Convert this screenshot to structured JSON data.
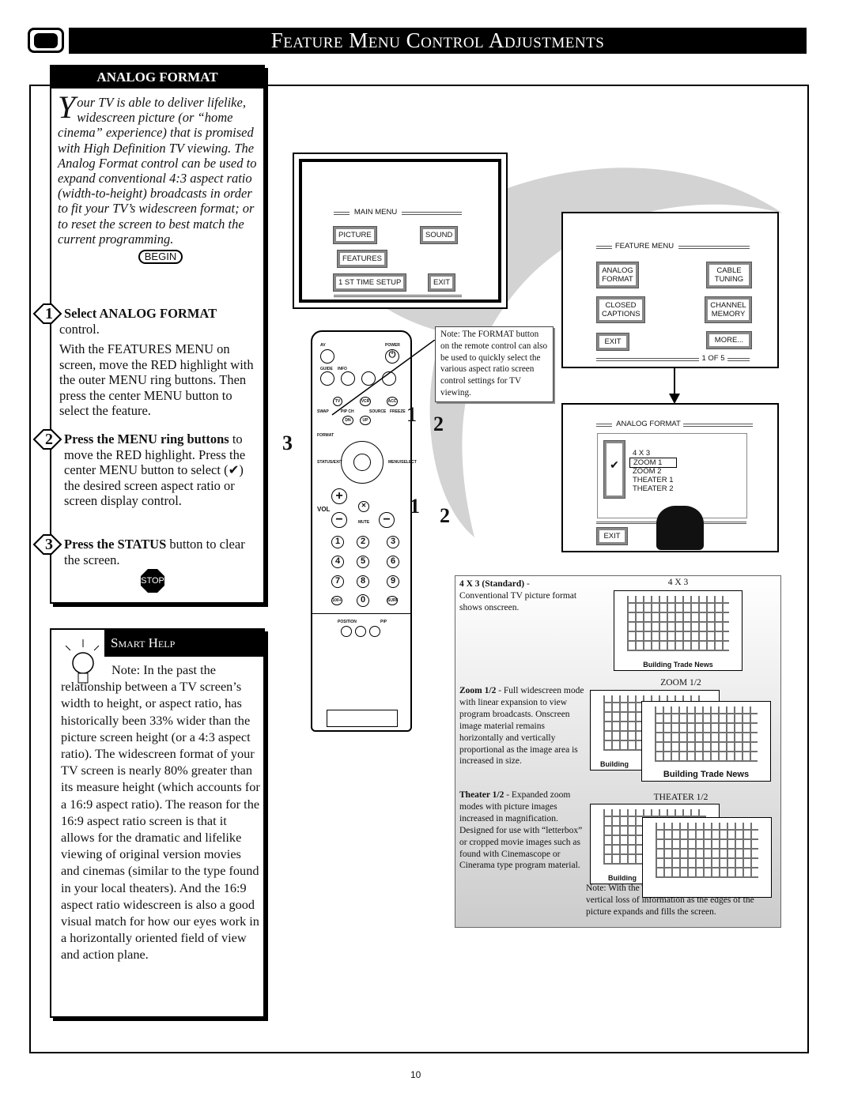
{
  "header": {
    "title": "Feature Menu Control Adjustments",
    "tv_icon": "tv-icon"
  },
  "analog_panel": {
    "heading": "ANALOG FORMAT",
    "intro_drop": "Y",
    "intro": "our TV is able to deliver lifelike, widescreen picture (or “home cinema” experience) that is promised with High Definition TV viewing. The Analog Format control can be used to expand conventional 4:3 aspect ratio (width-to-height) broadcasts in order to fit your TV’s widescreen format; or to reset the screen to best match the current programming.",
    "begin": "BEGIN",
    "steps": [
      {
        "n": "1",
        "bold": "Select ANALOG FORMAT",
        "rest": " control.",
        "body": "With the FEATURES MENU on screen, move the RED highlight with the outer MENU ring buttons. Then press the center MENU button to select the feature."
      },
      {
        "n": "2",
        "bold": "Press the MENU ring buttons",
        "rest": " to move the RED highlight. Press the center MENU button to select (✔) the desired screen aspect ratio or screen display control."
      },
      {
        "n": "3",
        "bold": "Press the STATUS",
        "rest": " button to clear the screen."
      }
    ],
    "stop": "STOP"
  },
  "smart_help": {
    "heading": "Smart Help",
    "text": "Note: In the past the relationship between a TV screen’s width to height, or aspect ratio, has historically been 33% wider than the picture screen height (or a 4:3 aspect ratio). The widescreen format of your TV screen is nearly 80% greater than its measure height (which accounts for a 16:9 aspect ratio). The reason for the 16:9 aspect ratio screen is that it allows for the dramatic and lifelike viewing of original version movies and cinemas (similar to the type found in your local theaters). And the 16:9 aspect ratio widescreen is also a good visual match for how our eyes work in a horizontally oriented field of view and action plane."
  },
  "main_menu": {
    "title": "MAIN MENU",
    "buttons": [
      "PICTURE",
      "SOUND",
      "FEATURES",
      "1 ST TIME SETUP",
      "EXIT"
    ],
    "highlighted": "FEATURES"
  },
  "note": "Note: The FORMAT button on the remote control can also be used to quickly select the various aspect ratio screen control settings for TV viewing.",
  "remote": {
    "labels": [
      "AV",
      "POWER",
      "GUIDE",
      "INFO",
      "TV",
      "VCR",
      "ACC",
      "SWAP",
      "PIP CH",
      "SOURCE",
      "FREEZE",
      "DN",
      "UP",
      "FORMAT",
      "STATUS/EXIT",
      "MENU/SELECT",
      "VOL",
      "MUTE",
      "POSITION",
      "PIP",
      "100+",
      "SURF"
    ],
    "digits": [
      "1",
      "2",
      "3",
      "4",
      "5",
      "6",
      "7",
      "8",
      "9",
      "0"
    ],
    "callouts": [
      "1",
      "2",
      "3",
      "1",
      "2"
    ]
  },
  "feature_menu": {
    "title": "FEATURE MENU",
    "buttons": [
      "ANALOG FORMAT",
      "CABLE TUNING",
      "CLOSED CAPTIONS",
      "CHANNEL MEMORY",
      "EXIT",
      "MORE..."
    ],
    "page": "1 OF 5",
    "highlighted": "ANALOG FORMAT"
  },
  "analog_menu": {
    "title": "ANALOG FORMAT",
    "options": [
      "4 X 3",
      "ZOOM 1",
      "ZOOM 2",
      "THEATER 1",
      "THEATER 2"
    ],
    "selected": "ZOOM 1",
    "check": "✔",
    "exit": "EXIT"
  },
  "formats": [
    {
      "bold": "4 X 3 (Standard)",
      "text": " - Conventional TV picture format shows onscreen.",
      "label": "4 X 3"
    },
    {
      "bold": "Zoom 1/2",
      "text": " - Full widescreen mode with linear expansion to view program broadcasts. Onscreen image material remains horizontally and vertically proportional as the image area is increased in size.",
      "label": "ZOOM 1/2"
    },
    {
      "bold": "Theater 1/2",
      "text": " - Expanded zoom modes with picture images increased in magnification. Designed for use with “letterbox” or cropped movie images such as found with Cinemascope or Cinerama type program material.",
      "note": "Note: With the Theater modes there can be some vertical loss of information as the edges of the picture expands and fills the screen.",
      "label": "THEATER 1/2"
    }
  ],
  "picture_caption": "Building Trade News",
  "picture_caption_cut": "Building",
  "page_number": "10"
}
